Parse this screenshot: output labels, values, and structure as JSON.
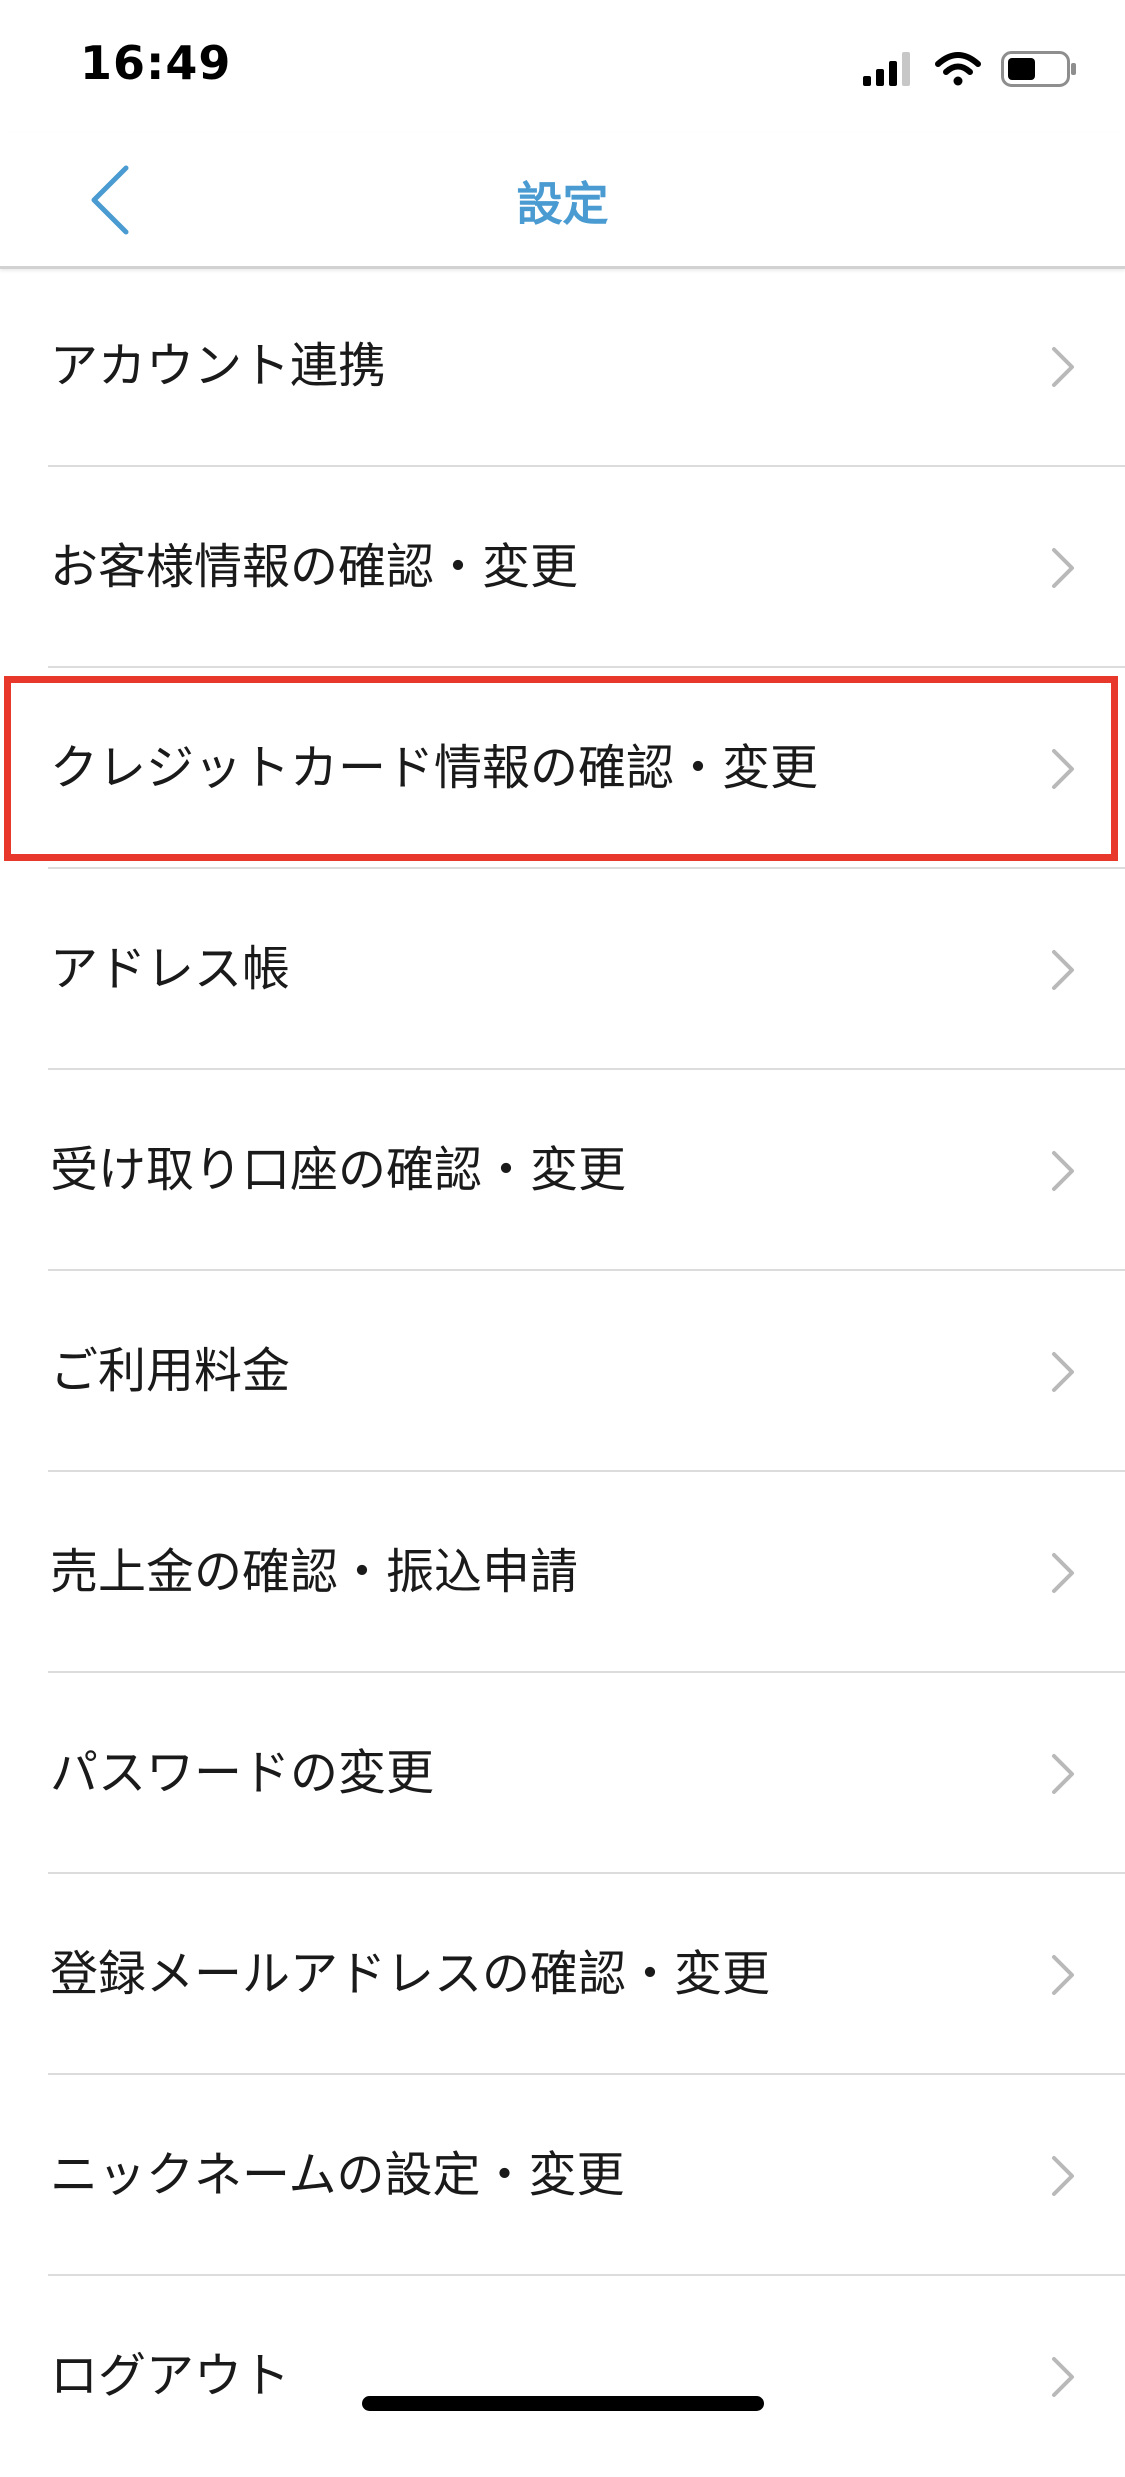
{
  "status_bar": {
    "time": "16:49",
    "icons": [
      "cellular-signal-icon",
      "wifi-icon",
      "battery-icon"
    ]
  },
  "nav": {
    "title": "設定",
    "back_icon": "chevron-left-icon"
  },
  "menu": {
    "items": [
      {
        "label": "アカウント連携"
      },
      {
        "label": "お客様情報の確認・変更"
      },
      {
        "label": "クレジットカード情報の確認・変更",
        "highlighted": true
      },
      {
        "label": "アドレス帳"
      },
      {
        "label": "受け取り口座の確認・変更"
      },
      {
        "label": "ご利用料金"
      },
      {
        "label": "売上金の確認・振込申請"
      },
      {
        "label": "パスワードの変更"
      },
      {
        "label": "登録メールアドレスの確認・変更"
      },
      {
        "label": "ニックネームの設定・変更"
      },
      {
        "label": "ログアウト"
      }
    ],
    "item_icon": "chevron-right-icon"
  },
  "colors": {
    "accent": "#4a9bd1",
    "highlight": "#e8382c",
    "chevron": "#b9b9b9"
  }
}
